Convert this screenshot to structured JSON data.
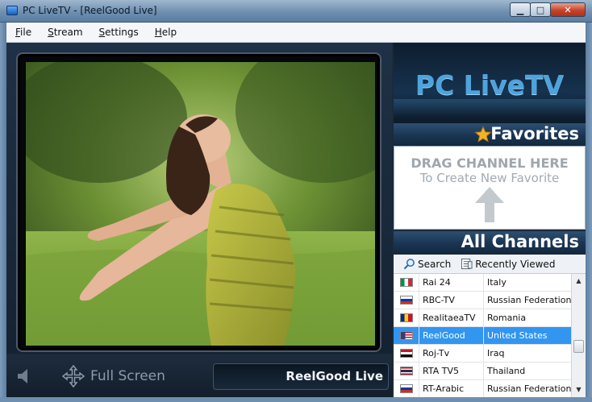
{
  "window": {
    "title": "PC LiveTV - [ReelGood Live]",
    "minimize_label": "▁",
    "maximize_label": "□",
    "close_label": "✕"
  },
  "menu": [
    {
      "hotkey": "F",
      "rest": "ile"
    },
    {
      "hotkey": "S",
      "rest": "tream"
    },
    {
      "hotkey": "S",
      "rest": "ettings"
    },
    {
      "hotkey": "H",
      "rest": "elp"
    }
  ],
  "controls": {
    "fullscreen_label": "Full Screen",
    "now_playing": "ReelGood Live"
  },
  "logo": {
    "text": "PC LiveTV"
  },
  "favorites": {
    "header": "Favorites",
    "drop_line1": "DRAG CHANNEL HERE",
    "drop_line2": "To Create New Favorite"
  },
  "all_channels": {
    "header": "All Channels",
    "search_label": "Search",
    "recent_label": "Recently Viewed",
    "rows": [
      {
        "name": "Rai 24",
        "country": "Italy",
        "flag": [
          "#009246",
          "#ffffff",
          "#ce2b37"
        ],
        "dir": "v"
      },
      {
        "name": "RBC-TV",
        "country": "Russian Federation",
        "flag": [
          "#ffffff",
          "#0039a6",
          "#d52b1e"
        ],
        "dir": "h"
      },
      {
        "name": "RealitaeaTV",
        "country": "Romania",
        "flag": [
          "#002b7f",
          "#fcd116",
          "#ce1126"
        ],
        "dir": "v"
      },
      {
        "name": "ReelGood",
        "country": "United States",
        "flag": [
          "#b22234",
          "#ffffff",
          "#3c3b6e"
        ],
        "dir": "us",
        "selected": true
      },
      {
        "name": "Roj-Tv",
        "country": "Iraq",
        "flag": [
          "#ce1126",
          "#ffffff",
          "#000000"
        ],
        "dir": "h"
      },
      {
        "name": "RTA TV5",
        "country": "Thailand",
        "flag": [
          "#a51931",
          "#f4f5f8",
          "#2d2a4a"
        ],
        "dir": "th"
      },
      {
        "name": "RT-Arabic",
        "country": "Russian Federation",
        "flag": [
          "#ffffff",
          "#0039a6",
          "#d52b1e"
        ],
        "dir": "h"
      }
    ]
  },
  "colors": {
    "accent_blue": "#3296f1",
    "logo_blue": "#4ea3dc",
    "star": "#f5b324"
  }
}
